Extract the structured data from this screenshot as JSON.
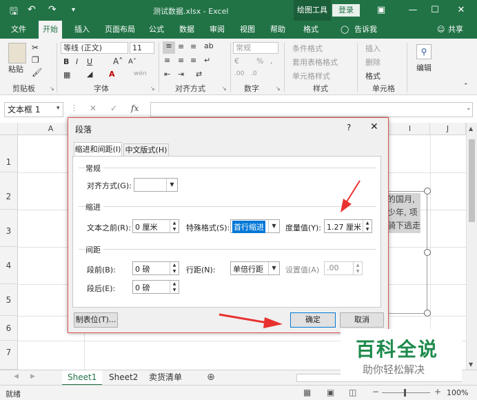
{
  "window": {
    "title": "测试数据.xlsx - Excel",
    "context_tool": "绘图工具",
    "login": "登录"
  },
  "ribbon_tabs": [
    "文件",
    "开始",
    "插入",
    "页面布局",
    "公式",
    "数据",
    "审阅",
    "视图",
    "帮助",
    "格式"
  ],
  "tell_me": "告诉我",
  "share": "共享",
  "ribbon": {
    "paste": "粘贴",
    "font_name": "等线 (正文)",
    "font_size": "11",
    "number_format": "常规",
    "conditional_format": "条件格式",
    "table_format": "套用表格格式",
    "cell_styles": "单元格样式",
    "insert": "插入",
    "delete": "删除",
    "format": "格式",
    "edit": "编辑",
    "groups": {
      "clipboard": "剪贴板",
      "font": "字体",
      "alignment": "对齐方式",
      "number": "数字",
      "styles": "样式",
      "cells": "单元格"
    }
  },
  "formula_bar": {
    "name_box": "文本框 1",
    "fx": "fx"
  },
  "columns": [
    "A",
    "I",
    "J"
  ],
  "rows": [
    "1",
    "2",
    "3",
    "4",
    "5",
    "6",
    "7"
  ],
  "sheet_text_lines": [
    "的国月,",
    "少年, 项",
    "骑下逃走"
  ],
  "sheets": [
    "Sheet1",
    "Sheet2",
    "卖货清单"
  ],
  "status": {
    "ready": "就绪",
    "zoom": "100%"
  },
  "dialog": {
    "title": "段落",
    "help": "?",
    "tabs": [
      "缩进和间距(I)",
      "中文版式(H)"
    ],
    "general": {
      "section": "常规",
      "alignment_label": "对齐方式(G):",
      "alignment_value": ""
    },
    "indent": {
      "section": "缩进",
      "before_text_label": "文本之前(R):",
      "before_text_value": "0 厘米",
      "special_label": "特殊格式(S):",
      "special_value": "首行缩进",
      "by_label": "度量值(Y):",
      "by_value": "1.27 厘米"
    },
    "spacing": {
      "section": "间距",
      "before_label": "段前(B):",
      "before_value": "0 磅",
      "after_label": "段后(E):",
      "after_value": "0 磅",
      "line_label": "行距(N):",
      "line_value": "单倍行距",
      "at_label": "设置值(A)",
      "at_value": ".00"
    },
    "tabs_button": "制表位(T)...",
    "ok": "确定",
    "cancel": "取消"
  },
  "watermark": {
    "title": "百科全说",
    "subtitle": "助你轻松解决"
  },
  "colors": {
    "excel_green": "#217346",
    "annotation_red": "#e8312f",
    "selection_blue": "#0078d7"
  }
}
